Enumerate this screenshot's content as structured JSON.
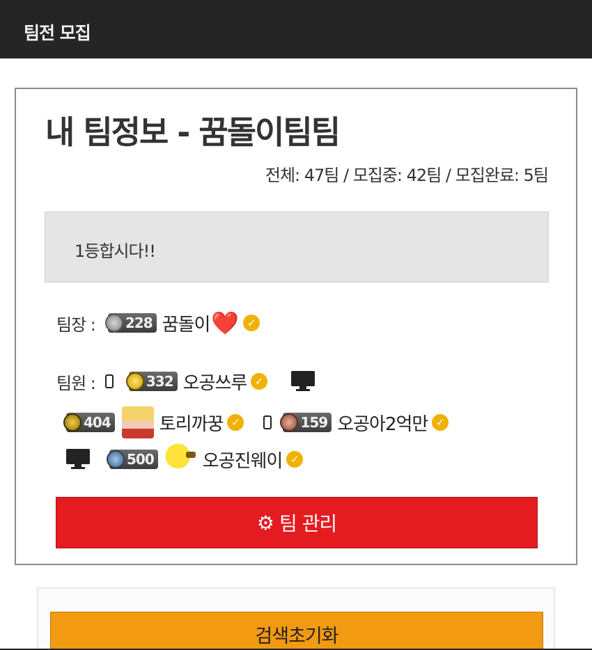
{
  "header": {
    "title": "팀전 모집"
  },
  "team": {
    "title": "내 팀정보 - 꿈돌이팀팀",
    "stats": "전체: 47팀 / 모집중: 42팀 / 모집완료: 5팀",
    "motto": "1등합시다!!",
    "leader_label": "팀장 :",
    "members_label": "팀원 :",
    "leader": {
      "level": "228",
      "name": "꿈돌이",
      "heart": "❤️",
      "verified": true
    },
    "members": [
      {
        "device": "mobile",
        "level": "332",
        "name": "오공쓰루",
        "verified": true
      },
      {
        "device": "pc",
        "level": "404",
        "name": "토리까꿍",
        "verified": true
      },
      {
        "device": "mobile",
        "level": "159",
        "name": "오공아2억만",
        "verified": true
      },
      {
        "device": "pc",
        "level": "500",
        "name": "오공진웨이",
        "verified": true
      }
    ],
    "manage_button": "팀 관리"
  },
  "search": {
    "reset_button": "검색초기화"
  },
  "icons": {
    "verified": "check-badge-icon",
    "mobile": "mobile-phone-icon",
    "pc": "desktop-monitor-icon",
    "gear": "gear-icon",
    "heart": "heart-icon"
  },
  "colors": {
    "topbar": "#252525",
    "manage": "#e41b1f",
    "reset": "#f29a12",
    "verified": "#f0b100"
  }
}
